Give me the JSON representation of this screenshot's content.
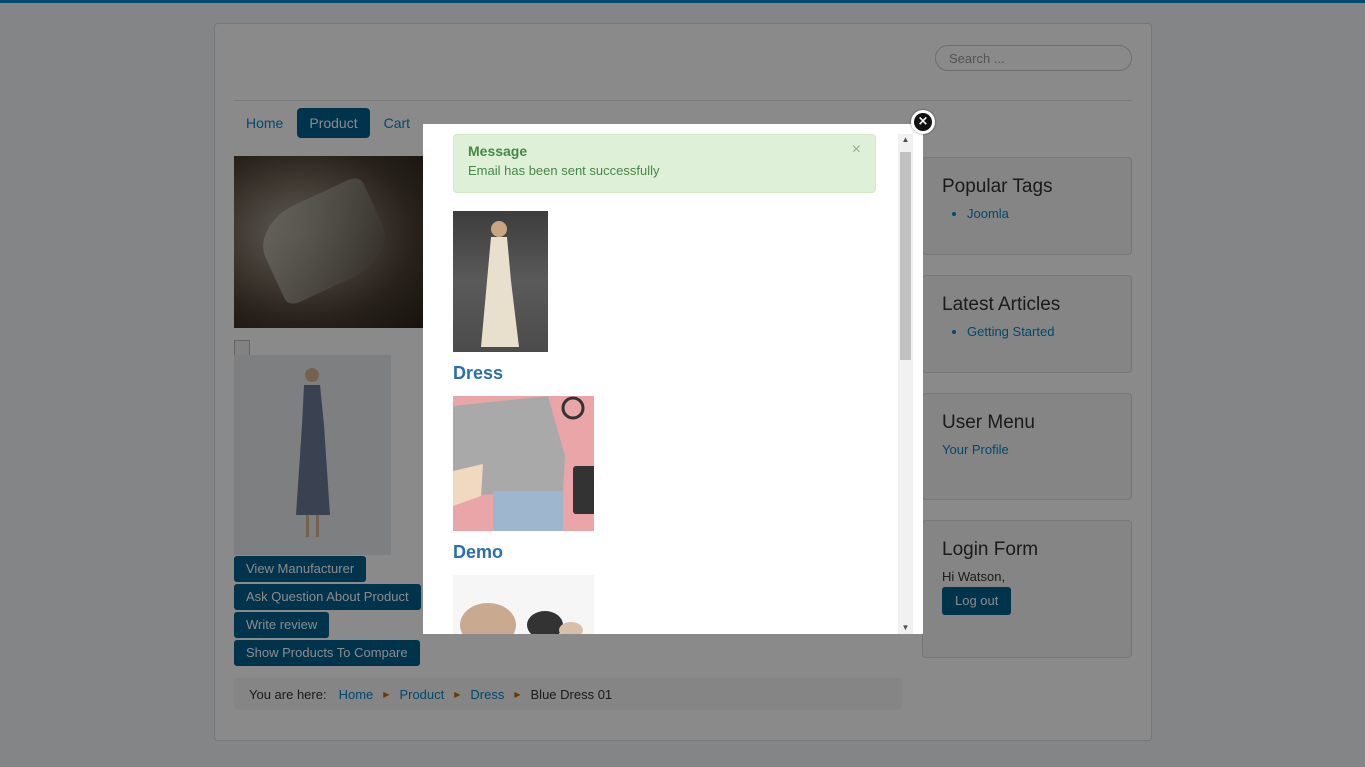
{
  "header": {
    "search_placeholder": "Search ..."
  },
  "nav": {
    "items": [
      {
        "label": "Home"
      },
      {
        "label": "Product",
        "active": true
      },
      {
        "label": "Cart"
      }
    ]
  },
  "product": {
    "buttons": [
      "View Manufacturer",
      "Ask Question About Product",
      "Write review",
      "Show Products To Compare"
    ]
  },
  "breadcrumb": {
    "label": "You are here:",
    "items": [
      "Home",
      "Product",
      "Dress"
    ],
    "current": "Blue Dress 01"
  },
  "sidebar": {
    "popular_tags": {
      "title": "Popular Tags",
      "items": [
        "Joomla"
      ]
    },
    "latest_articles": {
      "title": "Latest Articles",
      "items": [
        "Getting Started"
      ]
    },
    "user_menu": {
      "title": "User Menu",
      "link": "Your Profile"
    },
    "login_form": {
      "title": "Login Form",
      "greeting": "Hi Watson,",
      "logout_label": "Log out"
    }
  },
  "modal": {
    "alert": {
      "heading": "Message",
      "body": "Email has been sent successfully",
      "close": "×"
    },
    "categories": [
      {
        "title": "Dress"
      },
      {
        "title": "Demo"
      }
    ],
    "close_icon": "×"
  },
  "colors": {
    "primary": "#005e8d",
    "link": "#0088cc",
    "success_bg": "#dff0d8",
    "success_text": "#468847",
    "category_title": "#2a6ead"
  }
}
